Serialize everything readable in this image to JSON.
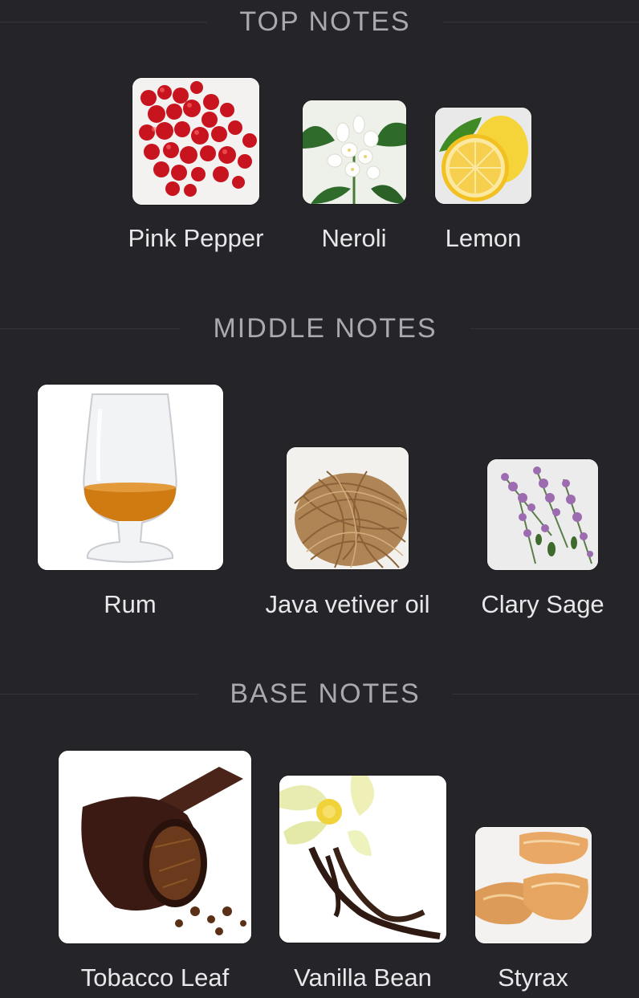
{
  "sections": {
    "top": {
      "title": "TOP NOTES",
      "notes": [
        {
          "label": "Pink Pepper",
          "icon": "pink-pepper-image"
        },
        {
          "label": "Neroli",
          "icon": "neroli-image"
        },
        {
          "label": "Lemon",
          "icon": "lemon-image"
        }
      ]
    },
    "middle": {
      "title": "MIDDLE NOTES",
      "notes": [
        {
          "label": "Rum",
          "icon": "rum-glass-image"
        },
        {
          "label": "Java vetiver oil",
          "icon": "vetiver-root-image"
        },
        {
          "label": "Clary Sage",
          "icon": "clary-sage-image"
        }
      ]
    },
    "base": {
      "title": "BASE NOTES",
      "notes": [
        {
          "label": "Tobacco Leaf",
          "icon": "tobacco-pipe-image"
        },
        {
          "label": "Vanilla Bean",
          "icon": "vanilla-bean-image"
        },
        {
          "label": "Styrax",
          "icon": "styrax-resin-image"
        }
      ]
    }
  },
  "colors": {
    "background": "#242429",
    "heading": "#a9a9b0",
    "label": "#e8e8ea"
  }
}
